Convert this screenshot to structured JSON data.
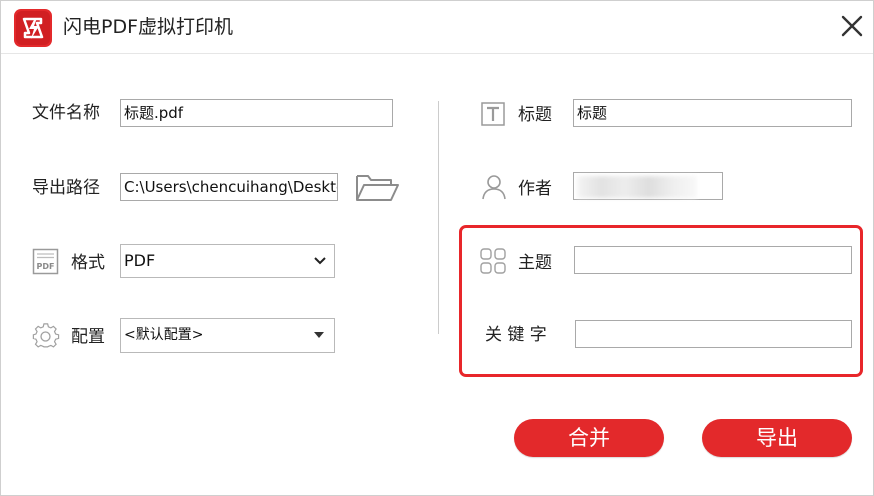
{
  "window": {
    "title": "闪电PDF虚拟打印机",
    "brand_color": "#e3292b",
    "close_icon": "close-icon"
  },
  "left": {
    "filename": {
      "label": "文件名称",
      "value": "标题.pdf"
    },
    "output_path": {
      "label": "导出路径",
      "value": "C:\\Users\\chencuihang\\Desktop",
      "icon": "folder-open-icon"
    },
    "format": {
      "label": "格式",
      "value": "PDF",
      "icon": "pdf-file-icon"
    },
    "config": {
      "label": "配置",
      "value": "<默认配置>",
      "icon": "gear-icon"
    }
  },
  "right": {
    "title": {
      "label": "标题",
      "value": "标题",
      "icon": "text-t-icon"
    },
    "author": {
      "label": "作者",
      "value": "",
      "icon": "user-icon"
    },
    "subject": {
      "label": "主题",
      "value": "",
      "icon": "grid-icon"
    },
    "keywords": {
      "label": "关 键 字",
      "value": ""
    }
  },
  "buttons": {
    "merge": "合并",
    "export": "导出"
  },
  "colors": {
    "accent": "#e3292b",
    "highlight_border": "#e8262a",
    "icon_gray": "#9a9a9a"
  }
}
